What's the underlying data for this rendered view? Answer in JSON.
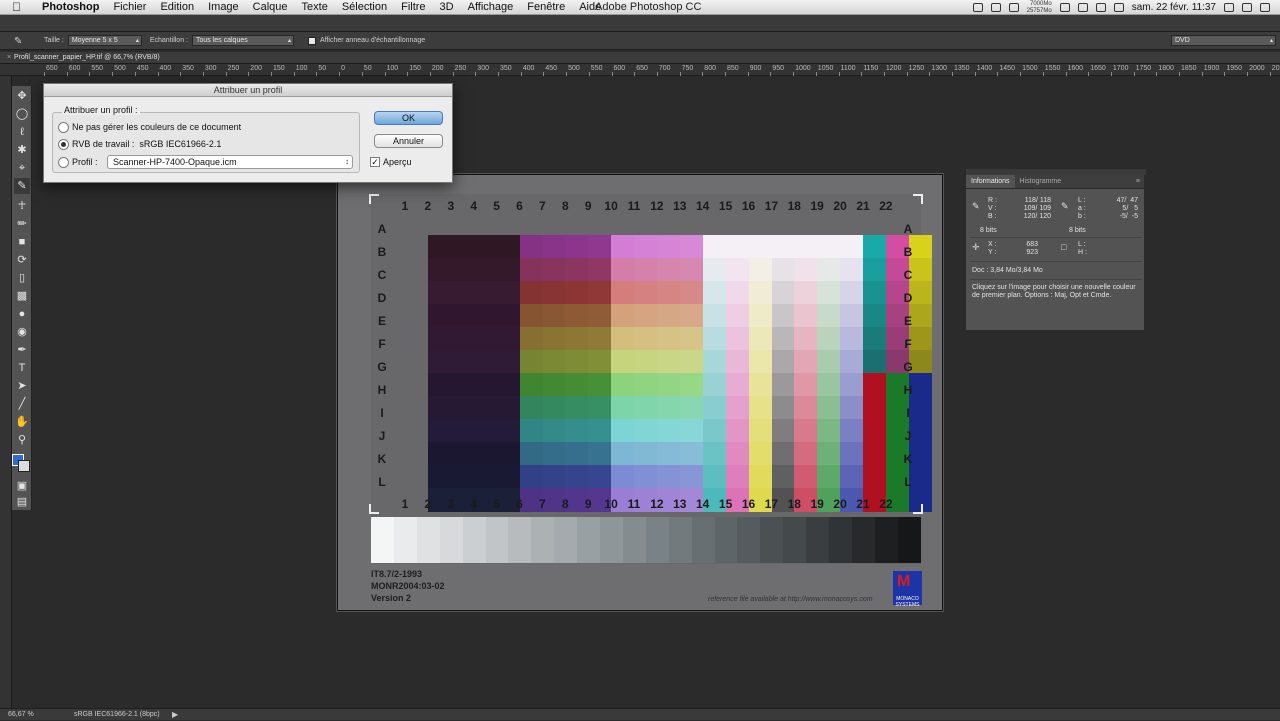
{
  "menubar": {
    "app": "Photoshop",
    "items": [
      "Fichier",
      "Edition",
      "Image",
      "Calque",
      "Texte",
      "Sélection",
      "Filtre",
      "3D",
      "Affichage",
      "Fenêtre",
      "Aide"
    ],
    "window_title": "Adobe Photoshop CC",
    "mem_top": "7000Mo",
    "mem_bottom": "25757Mo",
    "datetime": "sam. 22 févr.  11:37"
  },
  "options": {
    "size_label": "Taille :",
    "size_value": "Moyenne 5 x 5",
    "sample_label": "Echantillon :",
    "sample_value": "Tous les calques",
    "ring_label": "Afficher anneau d'échantillonnage",
    "workspace": "DVD"
  },
  "doc_tab": "Profil_scanner_papier_HP.tif @ 66,7% (RVB/8)",
  "ruler_numbers": [
    "650",
    "600",
    "550",
    "500",
    "450",
    "400",
    "350",
    "300",
    "250",
    "200",
    "150",
    "100",
    "50",
    "0",
    "50",
    "100",
    "150",
    "200",
    "250",
    "300",
    "350",
    "400",
    "450",
    "500",
    "550",
    "600",
    "650",
    "700",
    "750",
    "800",
    "850",
    "900",
    "950",
    "1000",
    "1050",
    "1100",
    "1150",
    "1200",
    "1250",
    "1300",
    "1350",
    "1400",
    "1450",
    "1500",
    "1550",
    "1600",
    "1650",
    "1700",
    "1750",
    "1800",
    "1850",
    "1900",
    "1950",
    "2000",
    "2050"
  ],
  "dialog": {
    "title": "Attribuer un profil",
    "group_label": "Attribuer un profil :",
    "opt1": "Ne pas gérer les couleurs de ce document",
    "opt2_label": "RVB de travail :",
    "opt2_value": "sRGB IEC61966-2.1",
    "opt3_label": "Profil :",
    "profile_value": "Scanner-HP-7400-Opaque.icm",
    "ok": "OK",
    "cancel": "Annuler",
    "preview": "Aperçu"
  },
  "target": {
    "columns": [
      "1",
      "2",
      "3",
      "4",
      "5",
      "6",
      "7",
      "8",
      "9",
      "10",
      "11",
      "12",
      "13",
      "14",
      "15",
      "16",
      "17",
      "18",
      "19",
      "20",
      "21",
      "22"
    ],
    "rows": [
      "A",
      "B",
      "C",
      "D",
      "E",
      "F",
      "G",
      "H",
      "I",
      "J",
      "K",
      "L"
    ],
    "footer_lines": [
      "IT8.7/2-1993",
      "MONR2004:03-02",
      "Version 2"
    ],
    "reference": "reference file available at http://www.monacosys.com",
    "logo_text": "MONACO SYSTEMS",
    "logo_mark": "M"
  },
  "info_panel": {
    "tabs": [
      "Informations",
      "Histogramme"
    ],
    "rgb_labels": "R :\nV :\nB :",
    "rgb_values": "118/ 118\n109/ 109\n120/ 120",
    "lab_labels": "L :\na :\nb :",
    "lab_values": "47/  47\n 5/   5\n-5/  -5",
    "bits_left": "8 bits",
    "bits_right": "8 bits",
    "xy_labels": "X :\nY :",
    "xy_values": "683\n923",
    "wh_labels": "L :\nH :",
    "doc": "Doc : 3,84 Mo/3,84 Mo",
    "hint": "Cliquez sur l'image pour choisir une nouvelle couleur de premier plan. Options : Maj, Opt et Cmde."
  },
  "status": {
    "zoom": "66,67 %",
    "profile": "sRGB IEC61966-2.1 (8bpc)"
  }
}
